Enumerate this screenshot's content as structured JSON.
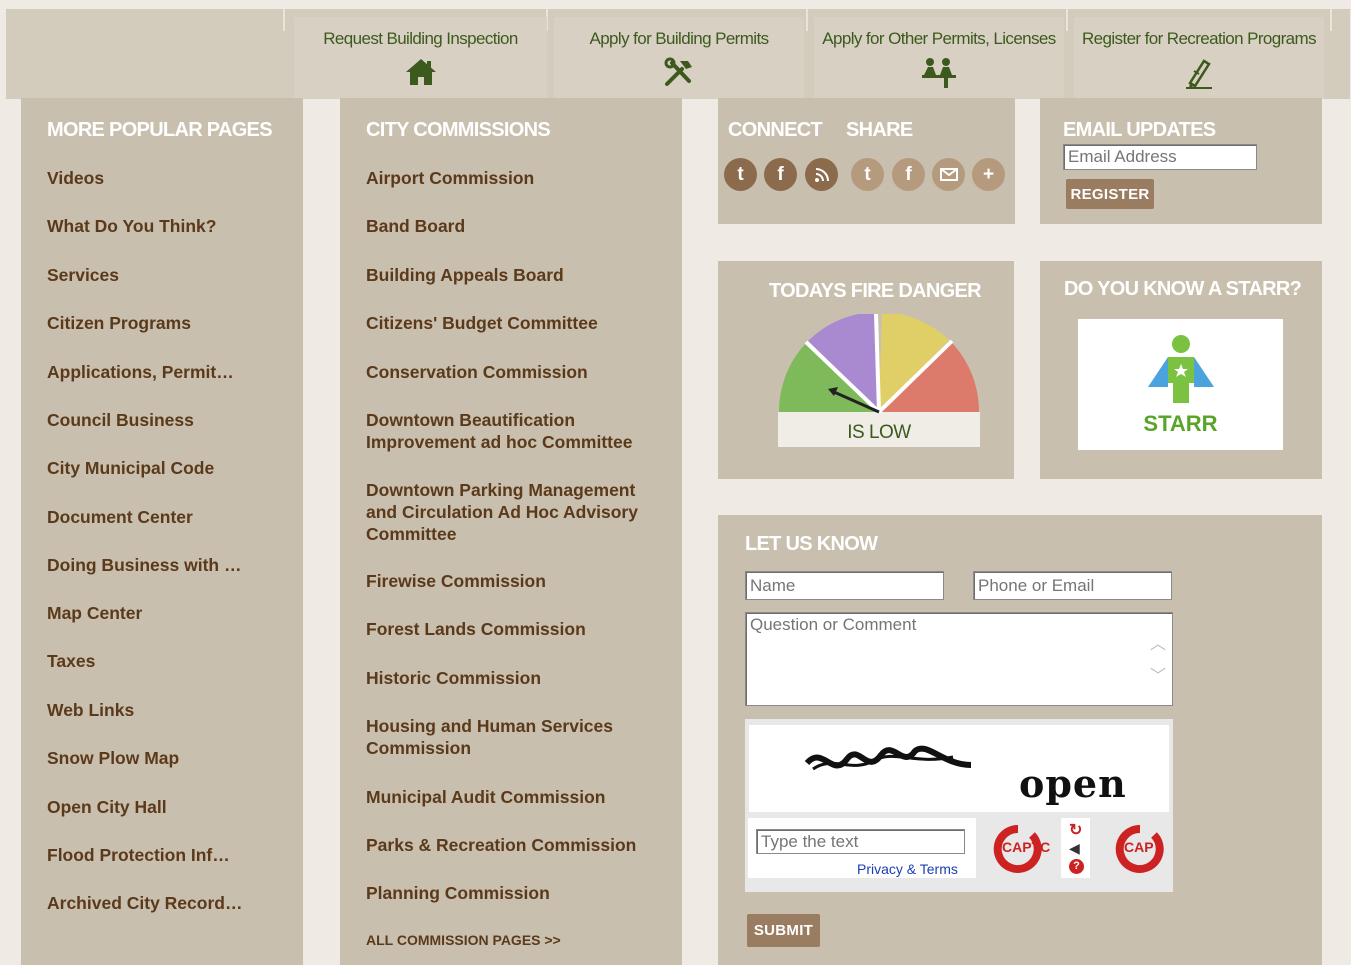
{
  "quick_links": [
    {
      "label": "Request Building Inspection",
      "icon": "house-icon"
    },
    {
      "label": "Apply for Building Permits",
      "icon": "tools-icon"
    },
    {
      "label": "Apply for Other Permits, Licenses",
      "icon": "people-icon"
    },
    {
      "label": "Register for Recreation Programs",
      "icon": "pencil-icon"
    }
  ],
  "popular": {
    "heading": "MORE POPULAR PAGES",
    "items": [
      "Videos",
      "What Do You Think?",
      "Services",
      "Citizen Programs",
      "Applications, Permit…",
      "Council Business",
      "City Municipal Code",
      "Document Center",
      "Doing Business with …",
      "Map Center",
      "Taxes",
      "Web Links",
      "Snow Plow Map",
      "Open City Hall",
      "Flood Protection Inf…",
      "Archived City Record…"
    ]
  },
  "commissions": {
    "heading": "CITY COMMISSIONS",
    "items": [
      "Airport Commission",
      "Band Board",
      "Building Appeals Board",
      "Citizens' Budget Committee",
      "Conservation Commission",
      "Downtown Beautification Improvement ad hoc Committee",
      "Downtown Parking Management and Circulation Ad Hoc Advisory Committee",
      "Firewise Commission",
      "Forest Lands Commission",
      "Historic Commission",
      "Housing and Human Services Commission",
      "Municipal Audit Commission",
      "Parks & Recreation Commission",
      "Planning Commission"
    ],
    "all_link": "ALL COMMISSION PAGES >>"
  },
  "connect": {
    "connect_heading": "CONNECT",
    "share_heading": "SHARE",
    "connect_icons": [
      "twitter-icon",
      "facebook-icon",
      "rss-icon"
    ],
    "share_icons": [
      "twitter-icon",
      "facebook-icon",
      "email-icon",
      "plus-icon"
    ]
  },
  "email_updates": {
    "heading": "EMAIL UPDATES",
    "placeholder": "Email Address",
    "button": "REGISTER"
  },
  "fire_danger": {
    "heading": "TODAYS FIRE DANGER",
    "status": "IS LOW",
    "level": "low",
    "colors": [
      "#7fba5a",
      "#a98ad0",
      "#e0cf66",
      "#dc7a6c"
    ]
  },
  "starr": {
    "heading": "DO YOU KNOW A STARR?",
    "logo_text": "STARR"
  },
  "let_us_know": {
    "heading": "LET US KNOW",
    "name_placeholder": "Name",
    "contact_placeholder": "Phone or Email",
    "comment_placeholder": "Question or Comment",
    "captcha_words": [
      "open"
    ],
    "captcha_input_placeholder": "Type the text",
    "privacy_link": "Privacy & Terms",
    "submit": "SUBMIT"
  }
}
